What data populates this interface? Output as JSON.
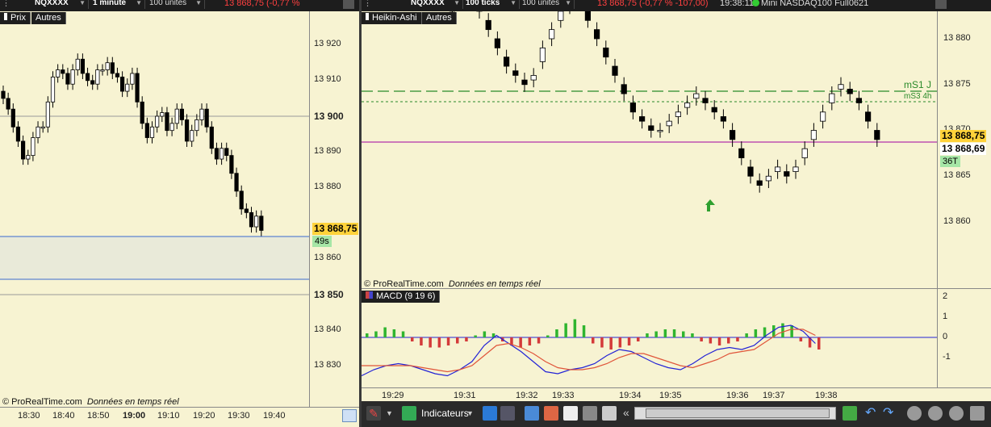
{
  "left": {
    "toolbar": {
      "symbol": "NQXXXX",
      "timeframe": "1 minute",
      "units": "100 unités",
      "price_info": "13 868,75 (-0,77 %"
    },
    "tabs": [
      "Prix",
      "Autres"
    ],
    "y_ticks": [
      "13 920",
      "13 910",
      "13 900",
      "13 890",
      "13 880",
      "13 860",
      "13 850",
      "13 840",
      "13 830"
    ],
    "bold_ticks": [
      "13 900",
      "13 850"
    ],
    "last_price": "13 868,75",
    "timer": "49s",
    "x_ticks": [
      "18:30",
      "18:40",
      "18:50",
      "19:00",
      "19:10",
      "19:20",
      "19:30",
      "19:40"
    ],
    "bold_x": "19:00",
    "copyright": "© ProRealTime.com",
    "copyright_sub": "Données en temps réel"
  },
  "right": {
    "toolbar": {
      "symbol": "NQXXXX",
      "ticks": "100 ticks",
      "units": "100 unités",
      "price_info": "13 868,75 (-0,77 % -107,00)",
      "time": "19:38:11",
      "instrument": "Mini NASDAQ100 Full0621"
    },
    "tabs": [
      "Heikin-Ashi",
      "Autres"
    ],
    "y_ticks": [
      "13 880",
      "13 875",
      "13 870",
      "13 865",
      "13 860"
    ],
    "last_price": "13 868,75",
    "second_price": "13 868,69",
    "tick_count": "36T",
    "level1": "mS1 J",
    "level2": "mS3 4h",
    "copyright": "© ProRealTime.com",
    "copyright_sub": "Données en temps réel",
    "macd_label": "MACD (9 19 6)",
    "macd_ticks": [
      "2",
      "1",
      "0",
      "-1"
    ],
    "x_ticks": [
      "19:29",
      "19:31",
      "19:32",
      "19:33",
      "19:34",
      "19:35",
      "19:36",
      "19:37",
      "19:38"
    ],
    "indicators_label": "Indicateurs"
  },
  "colors": {
    "background": "#f7f3d2",
    "bull": "#ffffff",
    "bear": "#000000",
    "hist_up": "#2fb52f",
    "hist_down": "#d43a3a",
    "macd_line": "#2323d6",
    "signal_line": "#e0553a",
    "level_dashed": "#2a8a2a",
    "last_price_line": "#a000a0",
    "price_tag": "#ffd23a"
  }
}
